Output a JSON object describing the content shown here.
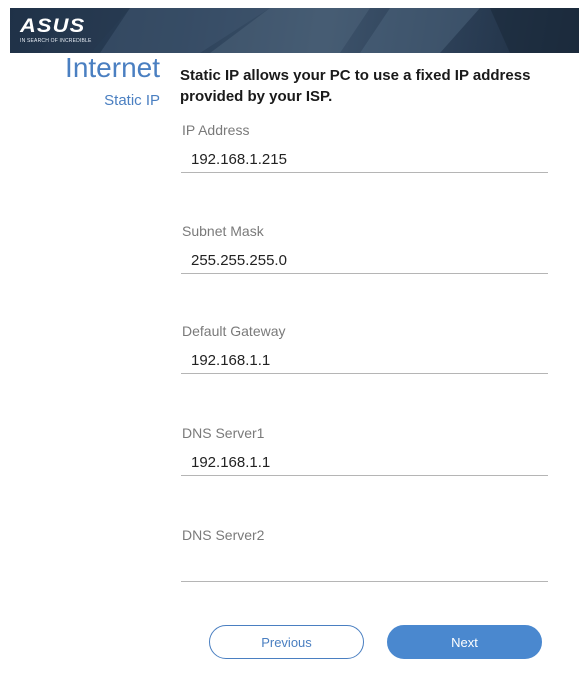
{
  "brand": {
    "logo_text": "ASUS",
    "tagline": "IN SEARCH OF INCREDIBLE"
  },
  "sidebar": {
    "title": "Internet",
    "subtitle": "Static IP"
  },
  "description": "Static IP allows your PC to use a fixed IP address provided by your ISP.",
  "fields": [
    {
      "label": "IP Address",
      "value": "192.168.1.215"
    },
    {
      "label": "Subnet Mask",
      "value": "255.255.255.0"
    },
    {
      "label": "Default Gateway",
      "value": "192.168.1.1"
    },
    {
      "label": "DNS Server1",
      "value": "192.168.1.1"
    },
    {
      "label": "DNS Server2",
      "value": ""
    }
  ],
  "buttons": {
    "previous": "Previous",
    "next": "Next"
  },
  "colors": {
    "accent": "#4a7fc1",
    "next_button": "#4a88cf",
    "banner": "#2c4159"
  }
}
